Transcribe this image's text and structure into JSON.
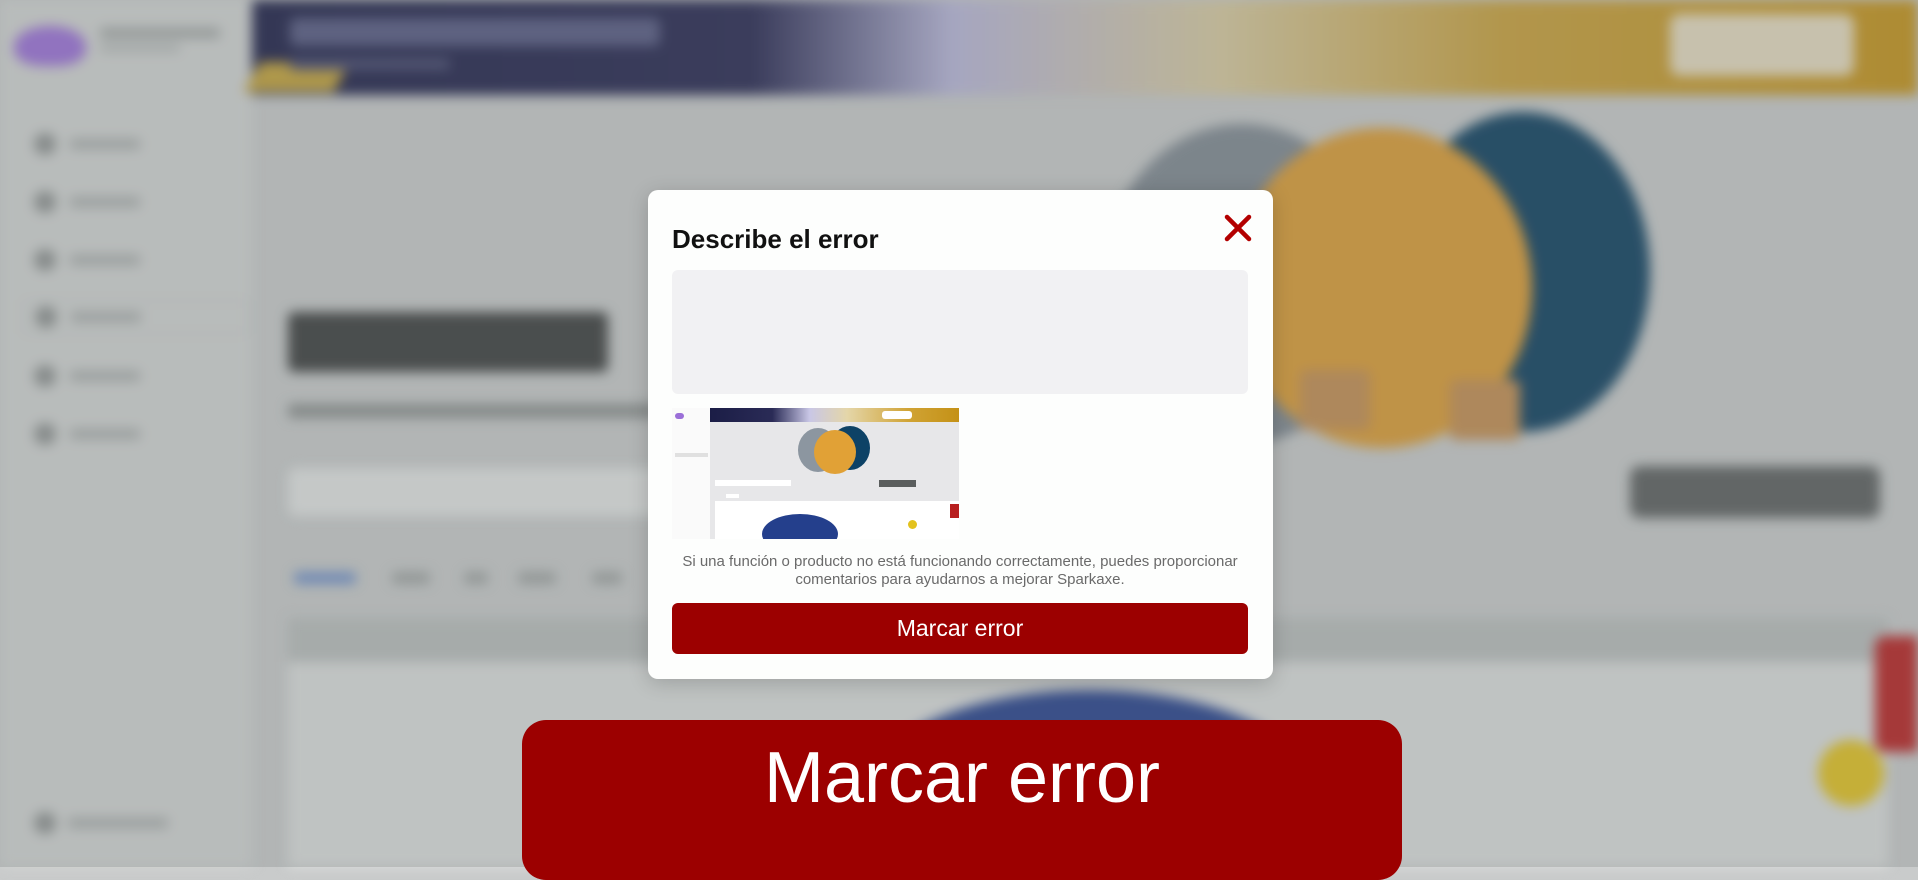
{
  "modal": {
    "title": "Describe el error",
    "textarea_value": "",
    "helper_text": "Si una función o producto no está funcionando correctamente, puedes proporcionar comentarios para ayudarnos a mejorar Sparkaxe.",
    "submit_label": "Marcar error",
    "close_icon": "close-icon"
  },
  "big_button": {
    "label": "Marcar error"
  },
  "colors": {
    "accent_red": "#9c0000",
    "close_icon_red": "#b30000",
    "header_navy": "#1b1d46",
    "header_gold": "#c49116"
  }
}
